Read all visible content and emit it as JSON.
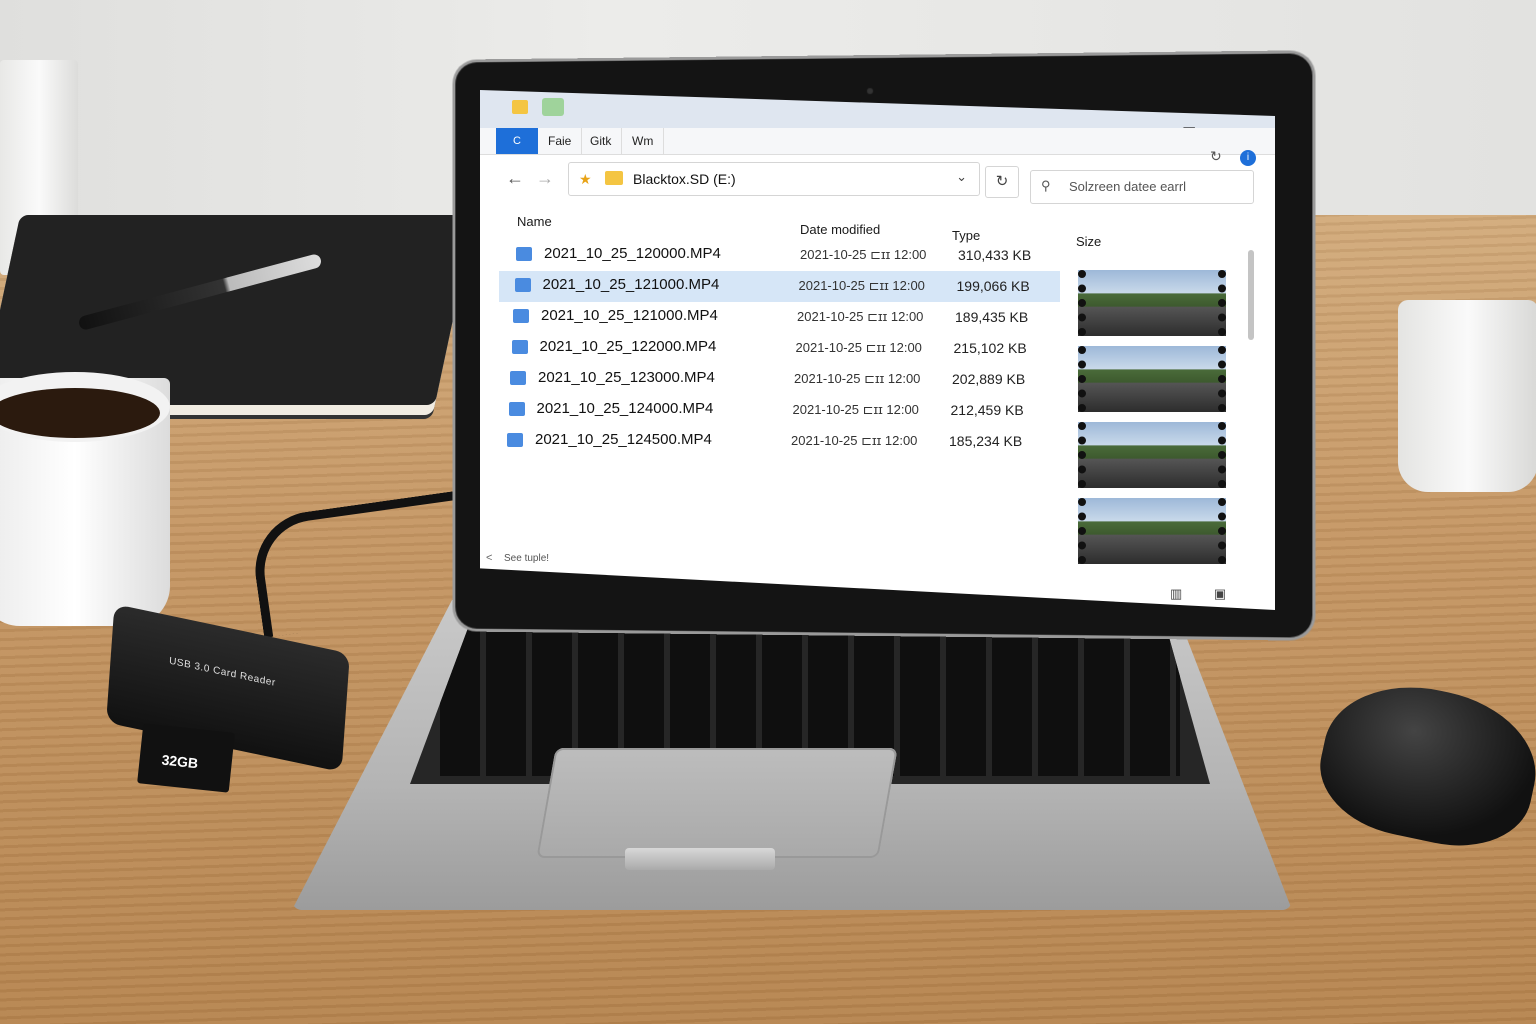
{
  "window": {
    "ribbon_first": "C",
    "ribbon_tabs": [
      "Faie",
      "Gitk",
      "Wm"
    ],
    "controls": {
      "minimize": "—",
      "maximize": "☐",
      "close": "✕"
    }
  },
  "address_bar": {
    "path": "Blacktox.SD (E:)",
    "refresh_icon": "refresh-icon"
  },
  "search": {
    "placeholder": "Solzreen datee earrl"
  },
  "columns": {
    "name": "Name",
    "date": "Date modified",
    "type": "Type",
    "size": "Size"
  },
  "files": [
    {
      "name": "2021_10_25_120000.MP4",
      "date": "2021-10-25 ⊏ɪɪ 12:00",
      "size": "310,433 KB"
    },
    {
      "name": "2021_10_25_121000.MP4",
      "date": "2021-10-25 ⊏ɪɪ 12:00",
      "size": "199,066 KB"
    },
    {
      "name": "2021_10_25_121000.MP4",
      "date": "2021-10-25 ⊏ɪɪ 12:00",
      "size": "189,435 KB"
    },
    {
      "name": "2021_10_25_122000.MP4",
      "date": "2021-10-25 ⊏ɪɪ 12:00",
      "size": "215,102 KB"
    },
    {
      "name": "2021_10_25_123000.MP4",
      "date": "2021-10-25 ⊏ɪɪ 12:00",
      "size": "202,889 KB"
    },
    {
      "name": "2021_10_25_124000.MP4",
      "date": "2021-10-25 ⊏ɪɪ 12:00",
      "size": "212,459 KB"
    },
    {
      "name": "2021_10_25_124500.MP4",
      "date": "2021-10-25 ⊏ɪɪ 12:00",
      "size": "185,234 KB"
    }
  ],
  "selected_index": 1,
  "status_bar": {
    "text": "See tuple!"
  },
  "desk": {
    "card_reader_label": "USB 3.0 Card Reader",
    "sd_card_label": "32GB"
  }
}
